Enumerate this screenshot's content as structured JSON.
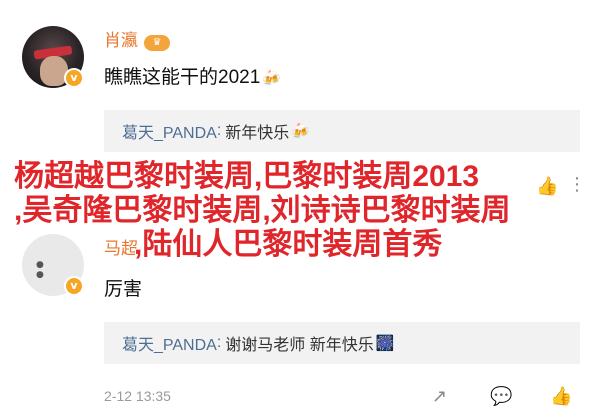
{
  "comments": [
    {
      "username": "肖瀛",
      "text": "瞧瞧这能干的2021",
      "reply": {
        "name": "葛天_PANDA",
        "text": "新年快乐"
      }
    },
    {
      "username": "马超",
      "text": "厉害",
      "reply": {
        "name": "葛天_PANDA",
        "text": "谢谢马老师  新年快乐"
      },
      "timestamp": "2-12 13:35"
    }
  ],
  "overlay": {
    "line1": "杨超越巴黎时装周,巴黎时装周2013",
    "line2": ",吴奇隆巴黎时装周,刘诗诗巴黎时装周",
    "line3": ",陆仙人巴黎时装周首秀"
  },
  "colors": {
    "username": "#e8772e",
    "reply_name": "#4f6e94",
    "overlay": "#e0262b"
  }
}
